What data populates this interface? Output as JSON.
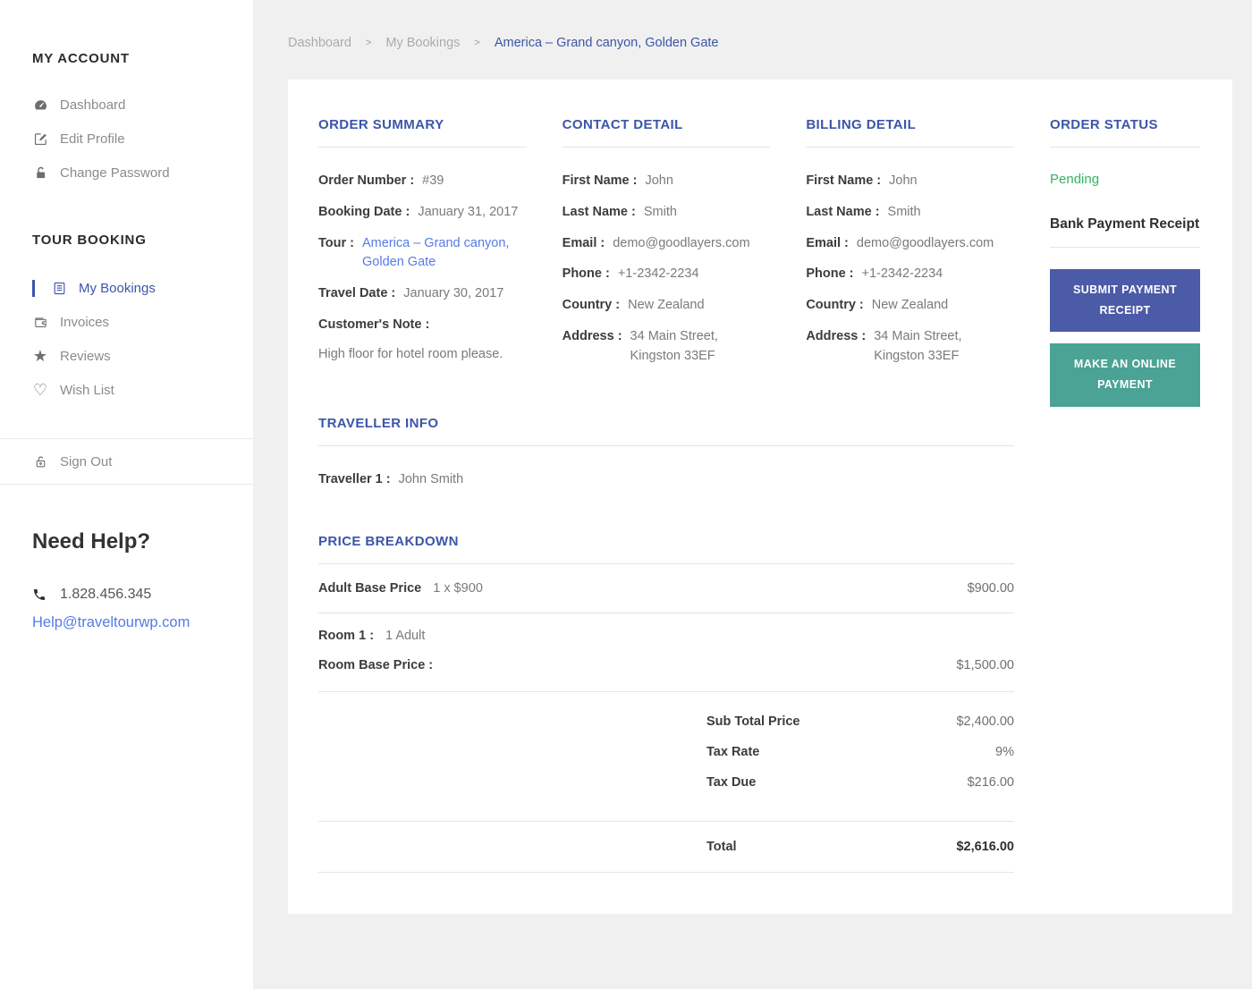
{
  "colors": {
    "accent_blue": "#3b56a8",
    "link_blue": "#567be5",
    "pending_green": "#34b462",
    "submit_button": "#4c5ba7",
    "online_button": "#4aa394",
    "page_bg": "#f0f0f0",
    "text_dark": "#3c3c3c",
    "text_gray": "#7a7a7a"
  },
  "sidebar": {
    "account": {
      "title": "MY ACCOUNT",
      "items": [
        {
          "icon": "dashboard-icon",
          "label": "Dashboard"
        },
        {
          "icon": "edit-icon",
          "label": "Edit Profile"
        },
        {
          "icon": "lock-icon",
          "label": "Change Password"
        }
      ]
    },
    "booking": {
      "title": "TOUR BOOKING",
      "items": [
        {
          "icon": "bookings-icon",
          "label": "My Bookings",
          "active": true
        },
        {
          "icon": "wallet-icon",
          "label": "Invoices"
        },
        {
          "icon": "star-icon",
          "label": "Reviews"
        },
        {
          "icon": "heart-icon",
          "label": "Wish List"
        }
      ]
    },
    "sign_out": {
      "icon": "unlock-icon",
      "label": "Sign Out"
    },
    "help": {
      "title": "Need Help?",
      "phone": "1.828.456.345",
      "email": "Help@traveltourwp.com"
    }
  },
  "breadcrumb": {
    "separator": ">",
    "items": [
      "Dashboard",
      "My Bookings",
      "America – Grand canyon, Golden Gate"
    ]
  },
  "order_summary": {
    "title": "ORDER SUMMARY",
    "fields": [
      {
        "label": "Order Number :",
        "value": "#39"
      },
      {
        "label": "Booking Date :",
        "value": "January 31, 2017"
      },
      {
        "label": "Tour :",
        "value": "America – Grand canyon, Golden Gate"
      },
      {
        "label": "Travel Date :",
        "value": "January 30, 2017"
      }
    ],
    "note_label": "Customer's Note :",
    "note": "High floor for hotel room please."
  },
  "contact_detail": {
    "title": "CONTACT DETAIL",
    "fields": [
      {
        "label": "First Name :",
        "value": "John"
      },
      {
        "label": "Last Name :",
        "value": "Smith"
      },
      {
        "label": "Email :",
        "value": "demo@goodlayers.com"
      },
      {
        "label": "Phone :",
        "value": "+1-2342-2234"
      },
      {
        "label": "Country :",
        "value": "New Zealand"
      },
      {
        "label": "Address :",
        "value": "34 Main Street,",
        "value2": "Kingston 33EF"
      }
    ]
  },
  "billing_detail": {
    "title": "BILLING DETAIL",
    "fields": [
      {
        "label": "First Name :",
        "value": "John"
      },
      {
        "label": "Last Name :",
        "value": "Smith"
      },
      {
        "label": "Email :",
        "value": "demo@goodlayers.com"
      },
      {
        "label": "Phone :",
        "value": "+1-2342-2234"
      },
      {
        "label": "Country :",
        "value": "New Zealand"
      },
      {
        "label": "Address :",
        "value": "34 Main Street,",
        "value2": "Kingston 33EF"
      }
    ]
  },
  "order_status": {
    "title": "ORDER STATUS",
    "status": "Pending",
    "receipt_label": "Bank Payment Receipt",
    "submit_button": "SUBMIT PAYMENT RECEIPT",
    "online_button": "MAKE AN ONLINE PAYMENT"
  },
  "traveller_info": {
    "title": "TRAVELLER INFO",
    "label": "Traveller 1 :",
    "value": "John Smith"
  },
  "price_breakdown": {
    "title": "PRICE BREAKDOWN",
    "adult_base": {
      "label": "Adult Base Price",
      "qty": "1 x $900",
      "amount": "$900.00"
    },
    "room": {
      "label": "Room 1 :",
      "value": "1 Adult"
    },
    "room_base": {
      "label": "Room Base Price :",
      "amount": "$1,500.00"
    },
    "totals": [
      {
        "label": "Sub Total Price",
        "value": "$2,400.00"
      },
      {
        "label": "Tax Rate",
        "value": "9%"
      },
      {
        "label": "Tax Due",
        "value": "$216.00"
      }
    ],
    "total": {
      "label": "Total",
      "value": "$2,616.00"
    }
  }
}
